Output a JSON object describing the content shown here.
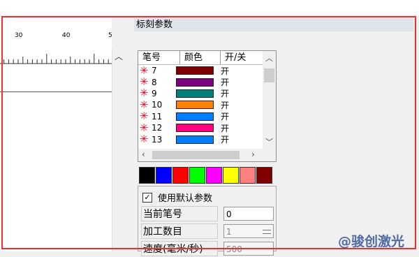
{
  "ruler": {
    "tick_labels": [
      "30",
      "40",
      "5"
    ]
  },
  "section": {
    "title": "标刻参数"
  },
  "pen_table": {
    "headers": [
      "笔号",
      "颜色",
      "开/关"
    ],
    "rows": [
      {
        "pen": "7",
        "color": "#7f0000",
        "state": "开"
      },
      {
        "pen": "8",
        "color": "#7f007f",
        "state": "开"
      },
      {
        "pen": "9",
        "color": "#007f7f",
        "state": "开"
      },
      {
        "pen": "10",
        "color": "#ff7f00",
        "state": "开"
      },
      {
        "pen": "11",
        "color": "#007fff",
        "state": "开"
      },
      {
        "pen": "12",
        "color": "#ff007f",
        "state": "开"
      },
      {
        "pen": "13",
        "color": "#007fff",
        "state": "开"
      }
    ]
  },
  "palette": [
    "#000000",
    "#0000ff",
    "#ff0000",
    "#00ff00",
    "#ff00ff",
    "#ffff00",
    "#ff8080",
    "#800000"
  ],
  "params": {
    "use_default_label": "使用默认参数",
    "use_default_checked": "✓",
    "current_pen_label": "当前笔号",
    "current_pen_value": "0",
    "process_count_label": "加工数目",
    "process_count_value": "1",
    "speed_label": "速度(毫米/秒)",
    "speed_value": "500"
  },
  "watermark": "@骏创激光"
}
